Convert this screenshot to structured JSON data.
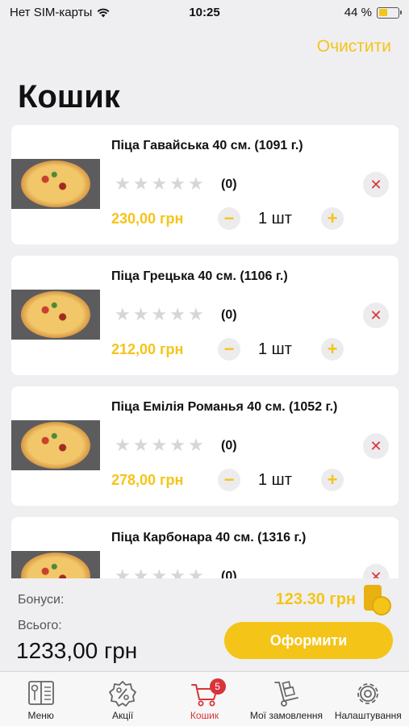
{
  "status_bar": {
    "carrier": "Нет SIM-карты",
    "time": "10:25",
    "battery": "44 %",
    "battery_level": 0.44
  },
  "header": {
    "clear_label": "Очистити",
    "title": "Кошик"
  },
  "cart_items": [
    {
      "title": "Піца Гавайська 40 см. (1091 г.)",
      "reviews": "(0)",
      "price": "230,00 грн",
      "qty": "1 шт",
      "rating": 0
    },
    {
      "title": "Піца Грецька 40 см. (1106 г.)",
      "reviews": "(0)",
      "price": "212,00 грн",
      "qty": "1 шт",
      "rating": 0
    },
    {
      "title": "Піца Емілія Романья 40 см. (1052 г.)",
      "reviews": "(0)",
      "price": "278,00 грн",
      "qty": "1 шт",
      "rating": 0
    },
    {
      "title": "Піца Карбонара 40 см. (1316 г.)",
      "reviews": "(0)",
      "price": "",
      "qty": "",
      "rating": 0
    }
  ],
  "controls": {
    "minus": "−",
    "plus": "+",
    "remove": "✕",
    "star": "★"
  },
  "footer": {
    "bonus_label": "Бонуси:",
    "bonus_value": "123.30 грн",
    "total_label": "Всього:",
    "total_value": "1233,00 грн",
    "checkout_label": "Оформити"
  },
  "tabs": [
    {
      "label": "Меню",
      "icon": "menu-book-icon"
    },
    {
      "label": "Акції",
      "icon": "discount-badge-icon"
    },
    {
      "label": "Кошик",
      "icon": "cart-icon",
      "badge": "5",
      "active": true
    },
    {
      "label": "Мої замовлення",
      "icon": "hand-truck-icon"
    },
    {
      "label": "Налаштування",
      "icon": "gear-icon"
    }
  ],
  "colors": {
    "accent": "#f5c418",
    "active": "#d8343a",
    "background": "#efeff1"
  }
}
